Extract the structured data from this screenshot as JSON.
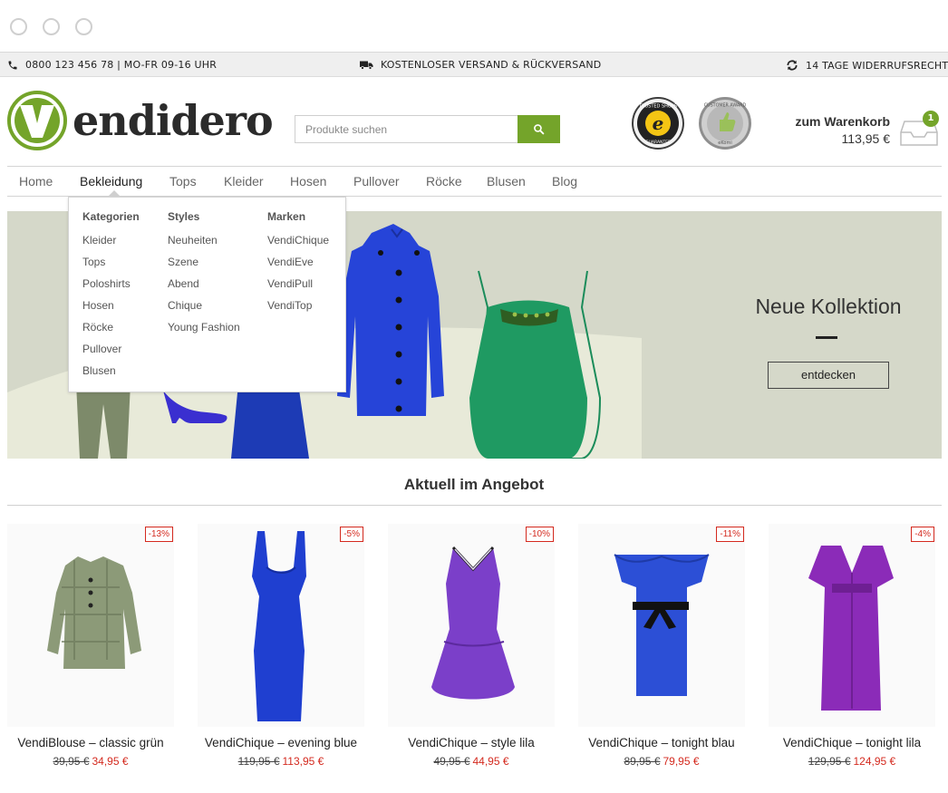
{
  "colors": {
    "brand_green": "#74a42a",
    "sale_red": "#d42a1f",
    "hero_bg": "#d5d8c9"
  },
  "infobar": {
    "phone": "0800 123 456 78 | MO-FR 09-16 UHR",
    "shipping": "KOSTENLOSER VERSAND & RÜCKVERSAND",
    "returns": "14 TAGE WIDERRUFSRECHT",
    "icons": [
      "phone-icon",
      "truck-icon",
      "refresh-icon"
    ]
  },
  "header": {
    "logo_text": "endidero",
    "search_placeholder": "Produkte suchen",
    "badges": [
      "TRUSTED SHOPS GUARANTEE",
      "CUSTOMER AWARD eKomi"
    ],
    "cart_label": "zum Warenkorb",
    "cart_total": "113,95 €",
    "cart_count": "1"
  },
  "nav": {
    "items": [
      "Home",
      "Bekleidung",
      "Tops",
      "Kleider",
      "Hosen",
      "Pullover",
      "Röcke",
      "Blusen",
      "Blog"
    ],
    "active": "Bekleidung"
  },
  "dropdown": {
    "kategorien": {
      "title": "Kategorien",
      "links": [
        "Kleider",
        "Tops",
        "Poloshirts",
        "Hosen",
        "Röcke",
        "Pullover",
        "Blusen"
      ]
    },
    "styles": {
      "title": "Styles",
      "links": [
        "Neuheiten",
        "Szene",
        "Abend",
        "Chique",
        "Young Fashion"
      ]
    },
    "marken": {
      "title": "Marken",
      "links": [
        "VendiChique",
        "VendiEve",
        "VendiPull",
        "VendiTop"
      ]
    }
  },
  "hero": {
    "title": "Neue Kollektion",
    "button": "entdecken"
  },
  "offers": {
    "title": "Aktuell im Angebot",
    "products": [
      {
        "name": "VendiBlouse – classic grün",
        "old_price": "39,95 €",
        "new_price": "34,95 €",
        "discount": "-13%"
      },
      {
        "name": "VendiChique – evening blue",
        "old_price": "119,95 €",
        "new_price": "113,95 €",
        "discount": "-5%"
      },
      {
        "name": "VendiChique – style lila",
        "old_price": "49,95 €",
        "new_price": "44,95 €",
        "discount": "-10%"
      },
      {
        "name": "VendiChique – tonight blau",
        "old_price": "89,95 €",
        "new_price": "79,95 €",
        "discount": "-11%"
      },
      {
        "name": "VendiChique – tonight lila",
        "old_price": "129,95 €",
        "new_price": "124,95 €",
        "discount": "-4%"
      }
    ]
  }
}
